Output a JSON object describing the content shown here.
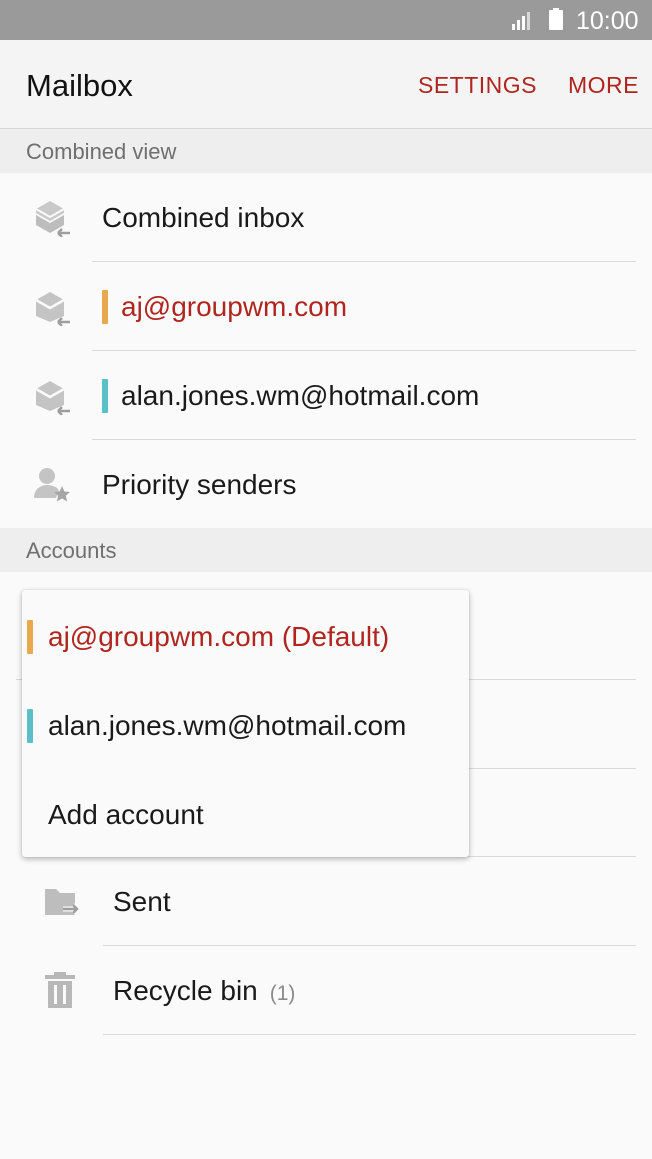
{
  "status_bar": {
    "time": "10:00"
  },
  "app_bar": {
    "title": "Mailbox",
    "settings_label": "SETTINGS",
    "more_label": "MORE"
  },
  "combined_view": {
    "header": "Combined view",
    "items": [
      {
        "label": "Combined inbox",
        "icon": "combined-inbox-icon"
      },
      {
        "label": "aj@groupwm.com",
        "icon": "inbox-icon",
        "accent": "#e8a94e"
      },
      {
        "label": "alan.jones.wm@hotmail.com",
        "icon": "inbox-icon",
        "accent": "#5bbfc7"
      },
      {
        "label": "Priority senders",
        "icon": "priority-sender-icon"
      }
    ]
  },
  "accounts": {
    "header": "Accounts"
  },
  "folders": [
    {
      "label": "Sent",
      "icon": "sent-folder-icon"
    },
    {
      "label": "Recycle bin",
      "count": "(1)",
      "icon": "trash-icon"
    }
  ],
  "account_menu": {
    "items": [
      {
        "label": "aj@groupwm.com (Default)",
        "accent": "#e8a94e"
      },
      {
        "label": "alan.jones.wm@hotmail.com",
        "accent": "#5bbfc7"
      },
      {
        "label": "Add account"
      }
    ]
  },
  "colors": {
    "accent_red": "#b0261f",
    "account1": "#e8a94e",
    "account2": "#5bbfc7"
  }
}
